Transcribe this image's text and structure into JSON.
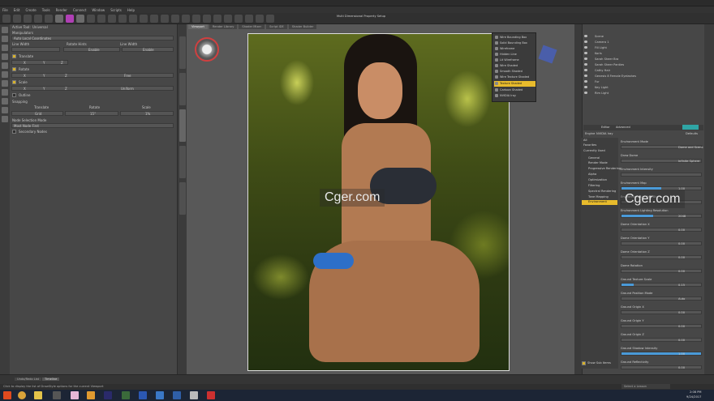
{
  "menu": [
    "File",
    "Edit",
    "Create",
    "Tools",
    "Render",
    "Connect",
    "Window",
    "Scripts",
    "Help"
  ],
  "left_panel": {
    "active_tool_label": "Active Tool:",
    "active_tool_value": "Universal",
    "section_manipulators": "Manipulators",
    "manip_value": "Auto Local Coordinates",
    "row_labels": [
      "Line Width",
      "Rotate Hints",
      "Line Width"
    ],
    "enable_labels": [
      "Enable",
      "Enable"
    ],
    "translate_label": "Translate",
    "rotate_label": "Rotate",
    "scale_label": "Scale",
    "axes": [
      "X",
      "Y",
      "Z"
    ],
    "free_label": "Free",
    "uniform_label": "Uniform",
    "outline_label": "Outline",
    "snapping_label": "Snapping",
    "snap_headers": [
      "Translate",
      "Rotate",
      "Scale"
    ],
    "snap_values": [
      "Grid",
      "15°",
      "1%"
    ],
    "node_selection_label": "Node Selection Mode",
    "node_selection_value": "Most Node First",
    "secondary_nodes_label": "Secondary Nodes"
  },
  "viewport": {
    "tabs": [
      "Viewport",
      "Render Library",
      "Shader Mixer",
      "Script IDE",
      "Shader Builder"
    ],
    "header_text": "Multi Dimensional Property Setup"
  },
  "drawstyle_menu": {
    "items": [
      "Wire Bounding Box",
      "Solid Bounding Box",
      "Wireframe",
      "Hidden Line",
      "Lit Wireframe",
      "Wire Shaded",
      "Smooth Shaded",
      "Wire Texture Shaded",
      "Texture Shaded",
      "Cartoon Shaded",
      "NVIDIA Iray"
    ],
    "selected_index": 8
  },
  "scene": {
    "items": [
      "Scene",
      "Camera 1",
      "Fill Light",
      "Koris",
      "Sarah Sheer Bra",
      "Sarah Sheer Panties",
      "Cathy Hair",
      "Genesis 8 Female Eyelashes",
      "Fur",
      "Key Light",
      "Rim Light"
    ]
  },
  "render_settings": {
    "tabs": [
      "Editor",
      "Advanced"
    ],
    "preset_label": "Engine",
    "preset_value": "NVIDIA Iray",
    "defaults_label": "Defaults",
    "all_label": "All",
    "categories": [
      "Favorites",
      "Currently Used",
      "General",
      "Render Mode",
      "Progressive Rendering",
      "Alpha",
      "Optimization",
      "Filtering",
      "Spectral Rendering",
      "Tone Mapping",
      "Environment"
    ],
    "selected_category_index": 10,
    "properties": [
      "Environment Mode",
      "Draw Dome",
      "Environment Intensity",
      "Environment Map",
      "Environment Lighting Blur",
      "Environment Lighting Resolution",
      "Dome Orientation X",
      "Dome Orientation Y",
      "Dome Orientation Z",
      "Dome Rotation",
      "Ground Texture Scale",
      "Ground Position Mode",
      "Ground Origin X",
      "Ground Origin Y",
      "Ground Origin Z",
      "Ground Shadow Intensity",
      "Ground Reflectivity"
    ],
    "property_values": [
      "Dome and Scene",
      "Infinite Sphere",
      "",
      "1.00",
      "",
      "2048",
      "0.00",
      "0.00",
      "0.00",
      "0.00",
      "0.15",
      "Auto",
      "0.00",
      "0.00",
      "0.00",
      "1.00",
      "0.00"
    ],
    "slider_fills": [
      0,
      0,
      0,
      0.5,
      0,
      0.4,
      0,
      0,
      0,
      0,
      0.15,
      0,
      0,
      0,
      0,
      1,
      0
    ],
    "show_sub_items_label": "Show Sub Items"
  },
  "bottom": {
    "tabs": [
      "Undo/Redo List",
      "Timeline"
    ],
    "status": "Click to display the list of DrawStyle options for the current Viewport",
    "lesson_placeholder": "Select a Lesson"
  },
  "watermarks": [
    "Cger.com",
    "Cger.com"
  ],
  "taskbar": {
    "time": "2:08 PM",
    "date": "9/24/2017"
  }
}
